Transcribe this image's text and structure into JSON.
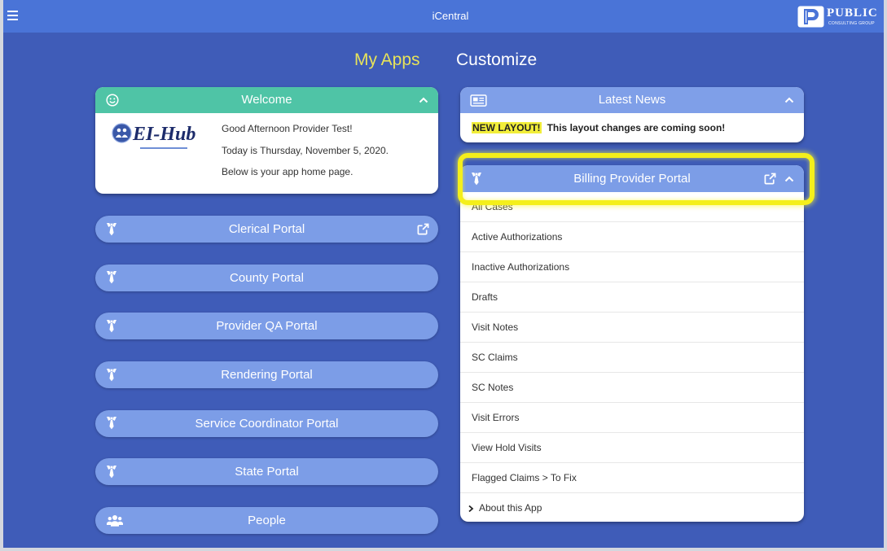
{
  "app": {
    "title": "iCentral",
    "menu_icon": "hamburger-icon"
  },
  "brand": {
    "logo_icon": "pcg-logo-icon",
    "name": "PUBLIC",
    "subtitle": "CONSULTING GROUP"
  },
  "tabs": [
    {
      "label": "My Apps",
      "active": true
    },
    {
      "label": "Customize",
      "active": false
    }
  ],
  "welcome": {
    "icon": "smiley-icon",
    "title": "Welcome",
    "logo_icon": "ei-hub-logo-icon",
    "logo_text": "EI-Hub",
    "lines": [
      "Good Afternoon Provider Test!",
      "Today is Thursday, November 5, 2020.",
      "Below is your app home page."
    ]
  },
  "portals": [
    {
      "label": "Clerical Portal",
      "icon": "tie-icon",
      "external_link": true
    },
    {
      "label": "County Portal",
      "icon": "tie-icon",
      "external_link": false
    },
    {
      "label": "Provider QA Portal",
      "icon": "tie-icon",
      "external_link": false
    },
    {
      "label": "Rendering Portal",
      "icon": "tie-icon",
      "external_link": false
    },
    {
      "label": "Service Coordinator Portal",
      "icon": "tie-icon",
      "external_link": false
    },
    {
      "label": "State Portal",
      "icon": "tie-icon",
      "external_link": false
    },
    {
      "label": "People",
      "icon": "people-icon",
      "external_link": false
    }
  ],
  "news": {
    "icon": "newspaper-icon",
    "title": "Latest News",
    "tag": "NEW LAYOUT!",
    "text": "This layout changes are coming soon!"
  },
  "billing": {
    "icon": "tie-icon",
    "title": "Billing Provider Portal",
    "external_link": true,
    "highlighted": true,
    "items": [
      "All Cases",
      "Active Authorizations",
      "Inactive Authorizations",
      "Drafts",
      "Visit Notes",
      "SC Claims",
      "SC Notes",
      "Visit Errors",
      "View Hold Visits",
      "Flagged Claims > To Fix"
    ],
    "footer": "About this App"
  },
  "colors": {
    "topbar": "#4a74d7",
    "background": "#3f5cb8",
    "active_tab": "#e7e35a",
    "welcome_header": "#4fc4a6",
    "portal_button": "#7c9de7",
    "highlight": "#f4ef1b"
  }
}
